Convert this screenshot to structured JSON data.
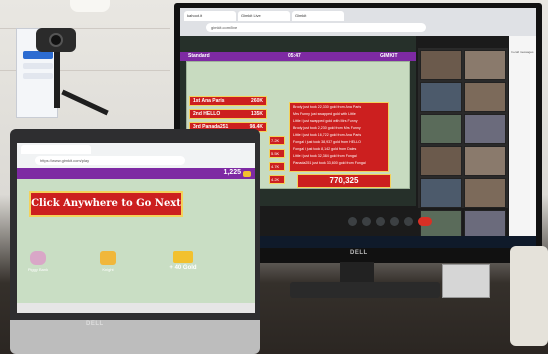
{
  "monitor": {
    "brand": "DELL",
    "browser": {
      "tabs": [
        "kahoot.it",
        "Gimkit Live",
        "Gimkit"
      ],
      "url": "gimkit.com/live"
    },
    "game": {
      "header_left": "Standard",
      "timer": "05:47",
      "header_right": "GIMKIT",
      "leaderboard": [
        {
          "rank": "1st",
          "name": "Ana Paris",
          "points": "260K"
        },
        {
          "rank": "2nd",
          "name": "HELLO",
          "points": "135K"
        },
        {
          "rank": "3rd",
          "name": "Panada251",
          "points": "98.4K"
        }
      ],
      "mini_scores": [
        "7.2K",
        "5.5K",
        "4.7K",
        "4.2K"
      ],
      "feed": [
        "Brody just took 22,330 gold from Ana Paris",
        "Mrs Funny just swapped gold with Little",
        "Little i just swapped gold with Mrs Funny",
        "Brody just took 2,230 gold from Mrs Funny",
        "Little i just took 16,722 gold from Ana Paris",
        "Fongal i just took 38,937 gold from HELLO",
        "Fongal i just took 8,142 gold from Dales",
        "Little i just took 32,384 gold from Fongal",
        "Panada251 just took 33,600 gold from Fongal"
      ],
      "total": "770,325"
    },
    "meeting": {
      "participants": [
        "",
        "",
        "",
        "",
        "",
        "",
        "",
        "",
        "",
        "",
        "",
        ""
      ],
      "chat": [
        "In-call messages",
        "",
        "",
        ""
      ]
    }
  },
  "laptop": {
    "brand": "DELL",
    "browser": {
      "tab": "",
      "url": "https://www.gimkit.com/play"
    },
    "gold": "1,225",
    "cta": "Click Anywhere to Go Next",
    "choices": [
      "Piggy Bank",
      "Knight",
      "+ 40 Gold"
    ]
  },
  "colors": {
    "game_red": "#cc1f1f",
    "game_purple": "#7e2aa3",
    "game_gold": "#f4d25a",
    "game_green": "#c8dbc0"
  }
}
